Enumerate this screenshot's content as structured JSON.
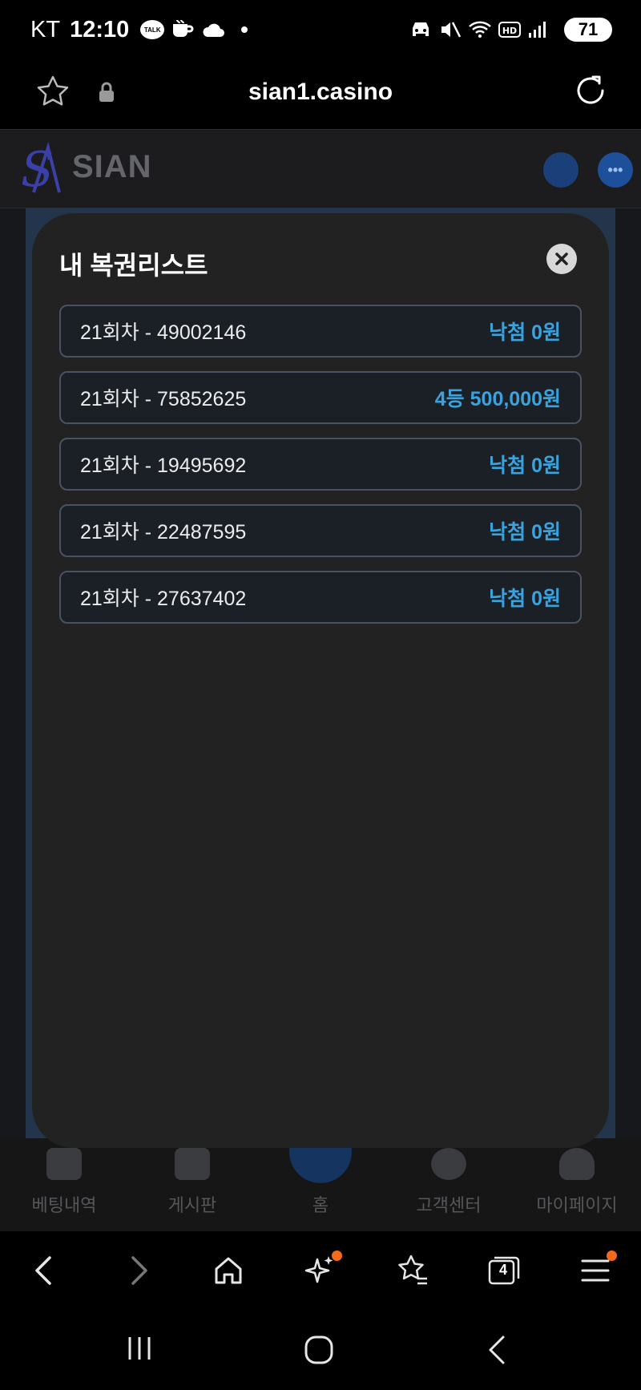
{
  "status_bar": {
    "carrier": "KT",
    "time": "12:10",
    "talk_badge": "TALK",
    "battery": "71"
  },
  "browser": {
    "url": "sian1.casino"
  },
  "site": {
    "logo_text": "SIAN"
  },
  "modal": {
    "title": "내 복권리스트",
    "tickets": [
      {
        "label": "21회차 - 49002146",
        "result": "낙첨 0원"
      },
      {
        "label": "21회차 - 75852625",
        "result": "4등 500,000원"
      },
      {
        "label": "21회차 - 19495692",
        "result": "낙첨 0원"
      },
      {
        "label": "21회차 - 22487595",
        "result": "낙첨 0원"
      },
      {
        "label": "21회차 - 27637402",
        "result": "낙첨 0원"
      }
    ]
  },
  "bottom_nav": {
    "items": [
      {
        "label": "베팅내역",
        "icon": "betting-history-icon"
      },
      {
        "label": "게시판",
        "icon": "board-icon"
      },
      {
        "label": "홈",
        "icon": "home-logo-icon"
      },
      {
        "label": "고객센터",
        "icon": "support-icon"
      },
      {
        "label": "마이페이지",
        "icon": "profile-icon"
      }
    ]
  },
  "toolbar": {
    "tab_count": "4"
  },
  "colors": {
    "accent": "#3aa3de",
    "modal_bg": "#222222",
    "ticket_border": "#4a5261",
    "badge": "#f26a1b"
  }
}
